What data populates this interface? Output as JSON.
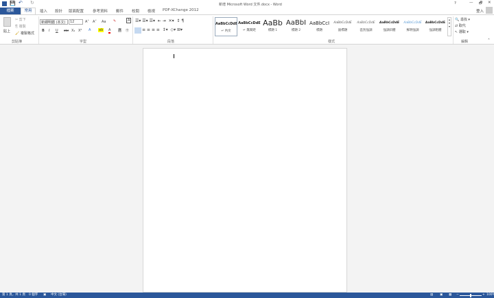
{
  "title": "新增 Microsoft Word 文件.docx - Word",
  "window": {
    "help": "?",
    "minimize": "—",
    "restore": "🗗",
    "close": "✕",
    "signin": "登入"
  },
  "tabs": [
    "檔案",
    "常用",
    "插入",
    "設計",
    "版面配置",
    "參考資料",
    "郵件",
    "校閱",
    "檢視",
    "PDF-XChange 2012"
  ],
  "clipboard": {
    "paste": "貼上",
    "cut": "剪下",
    "copy": "複製",
    "format_painter": "複製格式",
    "label": "剪貼簿"
  },
  "font": {
    "name": "新細明體 (本文)",
    "size": "12",
    "label": "字型",
    "bold": "B",
    "italic": "I",
    "underline": "U",
    "strike": "abc",
    "sub": "X₂",
    "sup": "X²",
    "grow": "A˄",
    "shrink": "A˅",
    "case": "Aa"
  },
  "paragraph": {
    "label": "段落"
  },
  "styles": {
    "label": "樣式",
    "items": [
      {
        "preview": "AaBbCcDdE",
        "name": "↵ 內文"
      },
      {
        "preview": "AaBbCcDdE",
        "name": "↵ 無間距"
      },
      {
        "preview": "AaBb",
        "name": "標題 1"
      },
      {
        "preview": "AaBbI",
        "name": "標題 2"
      },
      {
        "preview": "AaBbCcI",
        "name": "標題"
      },
      {
        "preview": "AaBbCcDdE",
        "name": "副標題"
      },
      {
        "preview": "AaBbCcDdE",
        "name": "區別強調"
      },
      {
        "preview": "AaBbCcDdE",
        "name": "強調斜體"
      },
      {
        "preview": "AaBbCcDdE",
        "name": "鮮明強調"
      },
      {
        "preview": "AaBbCcDdE",
        "name": "強調粗體"
      }
    ]
  },
  "editing": {
    "find": "尋找",
    "replace": "取代",
    "select": "選取",
    "label": "編輯"
  },
  "status": {
    "page": "第 1 頁，共 1 頁",
    "words": "0 個字",
    "language": "中文 (台灣)",
    "zoom": "100%"
  },
  "colors": {
    "accent": "#2b579a"
  }
}
